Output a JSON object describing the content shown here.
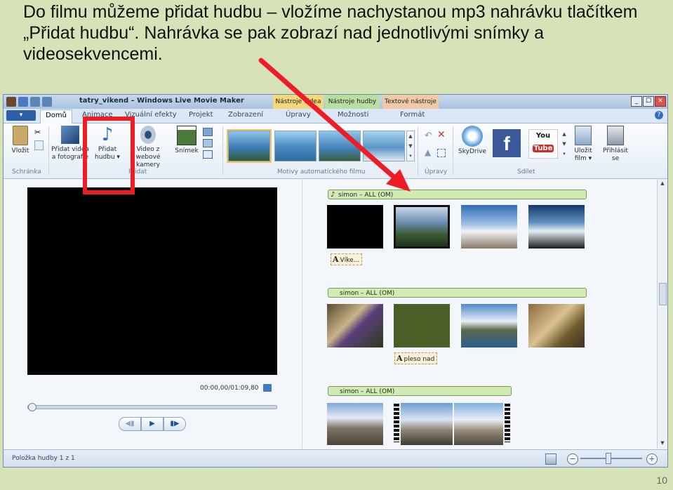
{
  "slide": {
    "title": "Do filmu můžeme přidat hudbu – vložíme nachystanou mp3 nahrávku tlačítkem „Přidat hudbu“. Nahrávka se pak zobrazí nad jednotlivými snímky a videosekvencemi.",
    "page_number": "10"
  },
  "window": {
    "title": "tatry_vikend – Windows Live Movie Maker",
    "context_tabs": [
      "Nástroje videa",
      "Nástroje hudby",
      "Textové nástroje"
    ],
    "controls": [
      "_",
      "☐",
      "✕"
    ]
  },
  "tabs": {
    "file_label": "▾",
    "items": [
      "Domů",
      "Animace",
      "Vizuální efekty",
      "Projekt",
      "Zobrazení",
      "Úpravy",
      "Možnosti",
      "Formát"
    ],
    "active": "Domů"
  },
  "ribbon": {
    "clipboard": {
      "paste": "Vložit",
      "group": "Schránka"
    },
    "add": {
      "add_video": "Přidat videa a fotografie",
      "add_music": "Přidat hudbu ▾",
      "webcam": "Video z webové kamery",
      "snapshot": "Snímek",
      "group": "Přidat"
    },
    "themes": {
      "group": "Motivy automatického filmu"
    },
    "edit": {
      "group": "Úpravy"
    },
    "share": {
      "skydrive": "SkyDrive",
      "save_movie": "Uložit film ▾",
      "sign_in": "Přihlásit se",
      "group": "Sdílet"
    }
  },
  "player": {
    "timecode": "00:00,00/01:09,80",
    "controls": [
      "◀▮",
      "▶",
      "▮▶"
    ]
  },
  "storyboard": {
    "music_label": "simon – ALL (OM)",
    "caption1": "Víke...",
    "caption2": "pleso nad"
  },
  "status": {
    "text": "Položka hudby 1 z 1",
    "zoom_out": "−",
    "zoom_in": "+"
  },
  "colors": {
    "highlight": "#ee1c25",
    "slide_background": "#d6e3b8",
    "music_bar": "#d2ebb6"
  }
}
